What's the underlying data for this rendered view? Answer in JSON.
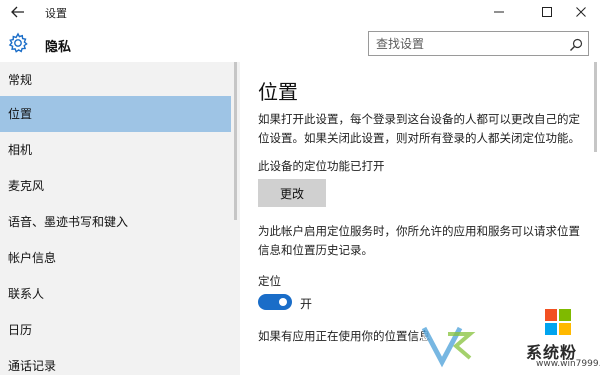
{
  "window": {
    "title": "设置"
  },
  "header": {
    "title": "隐私",
    "search_placeholder": "查找设置"
  },
  "sidebar": {
    "items": [
      {
        "label": "常规",
        "selected": false
      },
      {
        "label": "位置",
        "selected": true
      },
      {
        "label": "相机",
        "selected": false
      },
      {
        "label": "麦克风",
        "selected": false
      },
      {
        "label": "语音、墨迹书写和键入",
        "selected": false
      },
      {
        "label": "帐户信息",
        "selected": false
      },
      {
        "label": "联系人",
        "selected": false
      },
      {
        "label": "日历",
        "selected": false
      },
      {
        "label": "通话记录",
        "selected": false
      }
    ]
  },
  "main": {
    "title": "位置",
    "desc1": "如果打开此设置，每个登录到这台设备的人都可以更改自己的定位设置。如果关闭此设置，则对所有登录的人都关闭定位功能。",
    "status": "此设备的定位功能已打开",
    "change_button": "更改",
    "desc2": "为此帐户启用定位服务时，你所允许的应用和服务可以请求位置信息和位置历史记录。",
    "location_label": "定位",
    "toggle_state": "开",
    "toggle_on": true,
    "desc3": "如果有应用正在使用你的位置信息"
  },
  "watermark": {
    "brand": "系统粉",
    "url": "www.win7999.com"
  },
  "colors": {
    "accent": "#1a6dc8",
    "selected_bg": "#9ec4e5",
    "sidebar_bg": "#f2f2f2"
  }
}
